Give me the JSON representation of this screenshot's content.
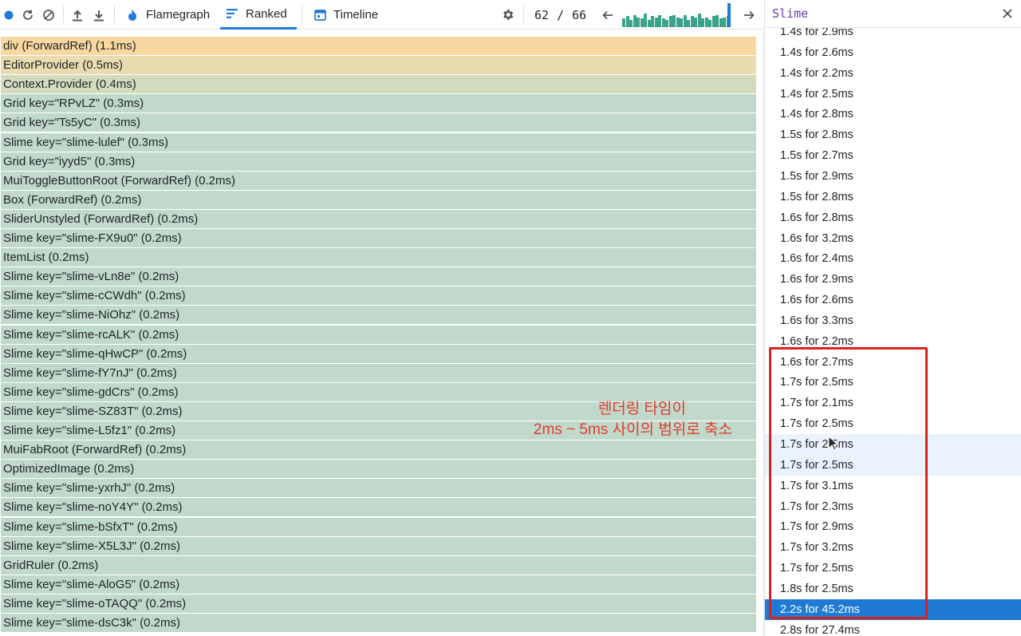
{
  "toolbar": {
    "record_icon": "record-dot-icon",
    "reload_icon": "reload-icon",
    "clear_icon": "clear-icon",
    "upload_icon": "upload-icon",
    "download_icon": "download-icon",
    "settings_icon": "gear-icon",
    "tabs": [
      {
        "label": "Flamegraph",
        "icon": "flame-icon",
        "active": false
      },
      {
        "label": "Ranked",
        "icon": "ranked-icon",
        "active": true
      },
      {
        "label": "Timeline",
        "icon": "calendar-icon",
        "active": false
      }
    ],
    "commit_current": "62",
    "commit_separator": "/",
    "commit_total": "66",
    "prev_icon": "arrow-left-icon",
    "next_icon": "arrow-right-icon",
    "commit_bar_levels": [
      0.35,
      0.45,
      0.3,
      0.5,
      0.4,
      0.35,
      0.55,
      0.3,
      0.45,
      0.4,
      0.5,
      0.35,
      0.3,
      0.45,
      0.5,
      0.4,
      0.35,
      0.5,
      0.3,
      0.45,
      0.4,
      0.55,
      0.35,
      0.4,
      0.3,
      0.45,
      0.5,
      0.35,
      0.4,
      0.45
    ],
    "colors": {
      "accent": "#1f7ad6",
      "bar": "#3aa389"
    }
  },
  "ranked": {
    "colors": {
      "top": "#f8d8a0",
      "second": "#e9dcb0",
      "third": "#d3dbbe",
      "rest": "#c0d9cb"
    },
    "rows": [
      "div (ForwardRef) (1.1ms)",
      "EditorProvider (0.5ms)",
      "Context.Provider (0.4ms)",
      "Grid key=\"RPvLZ\" (0.3ms)",
      "Grid key=\"Ts5yC\" (0.3ms)",
      "Slime key=\"slime-lulef\" (0.3ms)",
      "Grid key=\"iyyd5\" (0.3ms)",
      "MuiToggleButtonRoot (ForwardRef) (0.2ms)",
      "Box (ForwardRef) (0.2ms)",
      "SliderUnstyled (ForwardRef) (0.2ms)",
      "Slime key=\"slime-FX9u0\" (0.2ms)",
      "ItemList (0.2ms)",
      "Slime key=\"slime-vLn8e\" (0.2ms)",
      "Slime key=\"slime-cCWdh\" (0.2ms)",
      "Slime key=\"slime-NiOhz\" (0.2ms)",
      "Slime key=\"slime-rcALK\" (0.2ms)",
      "Slime key=\"slime-qHwCP\" (0.2ms)",
      "Slime key=\"slime-fY7nJ\" (0.2ms)",
      "Slime key=\"slime-gdCrs\" (0.2ms)",
      "Slime key=\"slime-SZ83T\" (0.2ms)",
      "Slime key=\"slime-L5fz1\" (0.2ms)",
      "MuiFabRoot (ForwardRef) (0.2ms)",
      "OptimizedImage (0.2ms)",
      "Slime key=\"slime-yxrhJ\" (0.2ms)",
      "Slime key=\"slime-noY4Y\" (0.2ms)",
      "Slime key=\"slime-bSfxT\" (0.2ms)",
      "Slime key=\"slime-X5L3J\" (0.2ms)",
      "GridRuler (0.2ms)",
      "Slime key=\"slime-AloG5\" (0.2ms)",
      "Slime key=\"slime-oTAQQ\" (0.2ms)",
      "Slime key=\"slime-dsC3k\" (0.2ms)"
    ]
  },
  "annotation": {
    "line1": "렌더링 타임이",
    "line2": "2ms ~ 5ms 사이의 범위로 축소",
    "color": "#e03b2e"
  },
  "side": {
    "title": "Slime",
    "close_icon": "close-icon",
    "commits": [
      {
        "label": "1.4s for 2.9ms",
        "state": "normal"
      },
      {
        "label": "1.4s for 2.6ms",
        "state": "normal"
      },
      {
        "label": "1.4s for 2.2ms",
        "state": "normal"
      },
      {
        "label": "1.4s for 2.5ms",
        "state": "normal"
      },
      {
        "label": "1.4s for 2.8ms",
        "state": "normal"
      },
      {
        "label": "1.5s for 2.8ms",
        "state": "normal"
      },
      {
        "label": "1.5s for 2.7ms",
        "state": "normal"
      },
      {
        "label": "1.5s for 2.9ms",
        "state": "normal"
      },
      {
        "label": "1.5s for 2.8ms",
        "state": "normal"
      },
      {
        "label": "1.6s for 2.8ms",
        "state": "normal"
      },
      {
        "label": "1.6s for 3.2ms",
        "state": "normal"
      },
      {
        "label": "1.6s for 2.4ms",
        "state": "normal"
      },
      {
        "label": "1.6s for 2.9ms",
        "state": "normal"
      },
      {
        "label": "1.6s for 2.6ms",
        "state": "normal"
      },
      {
        "label": "1.6s for 3.3ms",
        "state": "normal"
      },
      {
        "label": "1.6s for 2.2ms",
        "state": "normal"
      },
      {
        "label": "1.6s for 2.7ms",
        "state": "normal"
      },
      {
        "label": "1.7s for 2.5ms",
        "state": "normal"
      },
      {
        "label": "1.7s for 2.1ms",
        "state": "normal"
      },
      {
        "label": "1.7s for 2.5ms",
        "state": "normal"
      },
      {
        "label": "1.7s for 2.5ms",
        "state": "hover"
      },
      {
        "label": "1.7s for 2.5ms",
        "state": "hover"
      },
      {
        "label": "1.7s for 3.1ms",
        "state": "normal"
      },
      {
        "label": "1.7s for 2.3ms",
        "state": "normal"
      },
      {
        "label": "1.7s for 2.9ms",
        "state": "normal"
      },
      {
        "label": "1.7s for 3.2ms",
        "state": "normal"
      },
      {
        "label": "1.7s for 2.5ms",
        "state": "normal"
      },
      {
        "label": "1.8s for 2.5ms",
        "state": "normal"
      },
      {
        "label": "2.2s for 45.2ms",
        "state": "selected"
      },
      {
        "label": "2.8s for 27.4ms",
        "state": "normal"
      }
    ]
  }
}
